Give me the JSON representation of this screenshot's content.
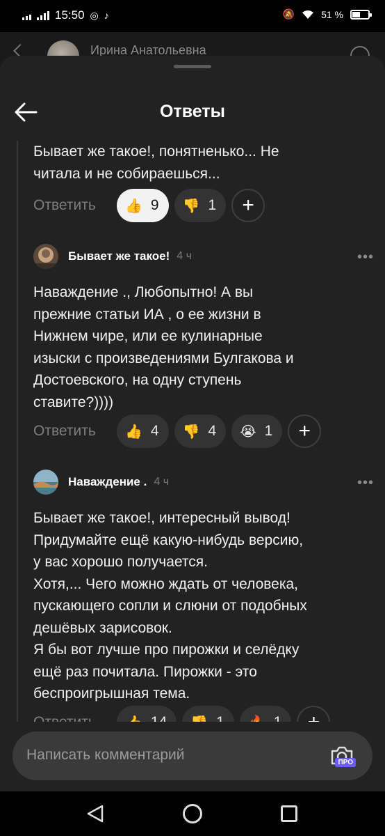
{
  "status_bar": {
    "time": "15:50",
    "battery_text": "51 %",
    "battery_level": 0.51
  },
  "background_page": {
    "author_name": "Ирина Анатольевна"
  },
  "sheet": {
    "title": "Ответы"
  },
  "comments": [
    {
      "text": "Бывает же такое!, понятненько... Не\nчитала и не собираешься...",
      "reply_label": "Ответить",
      "reactions": [
        {
          "icon": "thumbs-up-icon",
          "emoji": "👍",
          "count": "9",
          "active": true
        },
        {
          "icon": "thumbs-down-icon",
          "emoji": "👎",
          "count": "1",
          "active": false
        }
      ]
    },
    {
      "author": "Бывает же такое!",
      "time": "4 ч",
      "more": "•••",
      "text": "Наваждение ., Любопытно! А вы\nпрежние статьи ИА , о ее жизни в\nНижнем чире, или ее кулинарные\nизыски с произведениями Булгакова и\nДостоевского, на одну ступень\nставите?))))",
      "reply_label": "Ответить",
      "reactions": [
        {
          "icon": "thumbs-up-icon",
          "emoji": "👍",
          "count": "4",
          "active": false
        },
        {
          "icon": "thumbs-down-icon",
          "emoji": "👎",
          "count": "4",
          "active": false
        },
        {
          "icon": "crying-face-icon",
          "emoji": "😭",
          "count": "1",
          "active": false
        }
      ]
    },
    {
      "author": "Наваждение .",
      "time": "4 ч",
      "more": "•••",
      "text": "Бывает же такое!, интересный вывод!\nПридумайте ещё какую-нибудь версию,\nу вас хорошо получается.\nХотя,... Чего можно ждать от человека,\nпускающего сопли и слюни от подобных\nдешёвых  зарисовок.\nЯ бы вот лучше про пирожки и селёдку\nещё раз почитала. Пирожки - это\nбеспроигрышная тема.",
      "reply_label": "Ответить",
      "reactions": [
        {
          "icon": "thumbs-up-icon",
          "emoji": "👍",
          "count": "14",
          "active": false
        },
        {
          "icon": "thumbs-down-icon",
          "emoji": "👎",
          "count": "1",
          "active": false
        },
        {
          "icon": "fire-icon",
          "emoji": "🔥",
          "count": "1",
          "active": false
        }
      ]
    }
  ],
  "composer": {
    "placeholder": "Написать комментарий",
    "pro_badge": "ПРО"
  }
}
